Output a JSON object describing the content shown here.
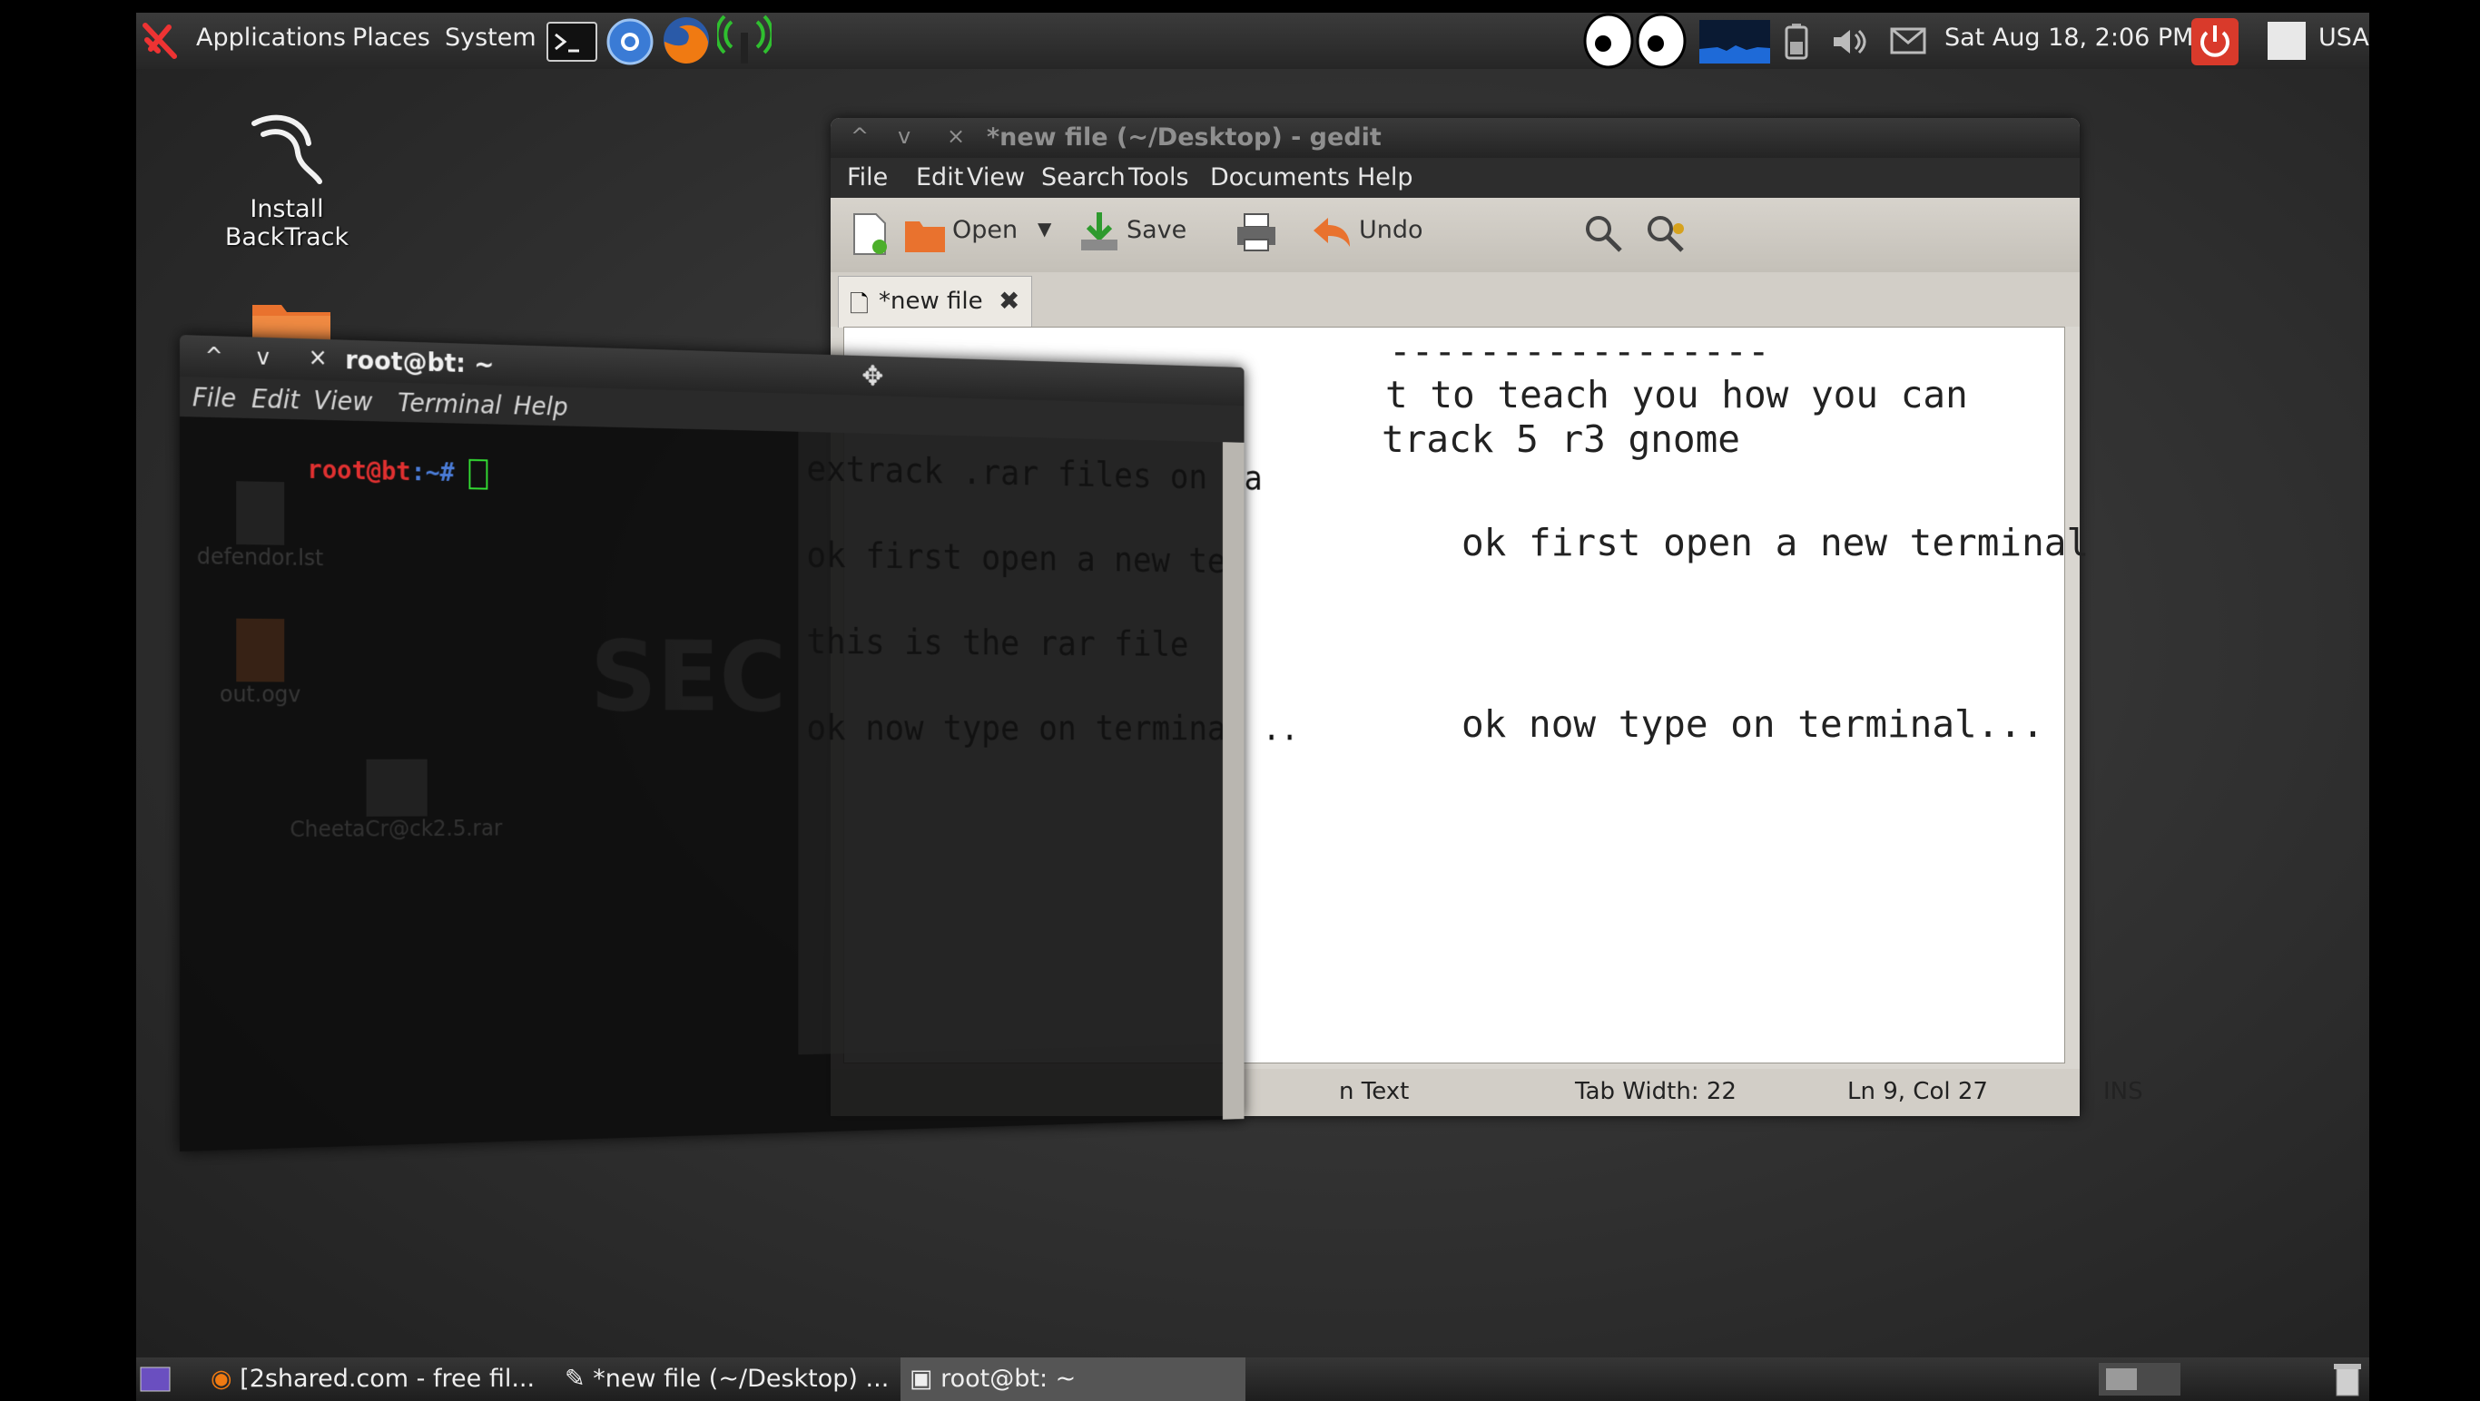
{
  "top_panel": {
    "menus": [
      "Applications",
      "Places",
      "System"
    ],
    "datetime": "Sat Aug 18,  2:06 PM",
    "keyboard_layout": "USA"
  },
  "desktop": {
    "install_label": "Install BackTrack",
    "faded_icons": [
      "defendor.lst",
      "out.ogv",
      "CheetaCr@ck2.5.rar"
    ],
    "wallpaper_text": "SEC"
  },
  "gedit": {
    "title": "*new file (~/Desktop) - gedit",
    "menu": [
      "File",
      "Edit",
      "View",
      "Search",
      "Tools",
      "Documents",
      "Help"
    ],
    "toolbar": {
      "open": "Open",
      "save": "Save",
      "undo": "Undo"
    },
    "tab_label": "*new file",
    "lines": [
      "-----------------",
      "t to teach you how you can",
      "track 5 r3 gnome",
      "ok first open a new terminal",
      "this is the rar file",
      "ok now type on terminal..."
    ],
    "lines_under_terminal": [
      "extrack .rar files on ba",
      "ok first open a new ter",
      "this is the rar file",
      "ok now type on terminal .."
    ],
    "status": {
      "lang": "n Text",
      "tab_width": "Tab Width: 22",
      "cursor": "Ln 9, Col 27",
      "mode": "INS"
    }
  },
  "terminal": {
    "title": "root@bt: ~",
    "menu": [
      "File",
      "Edit",
      "View",
      "Terminal",
      "Help"
    ],
    "prompt_user": "root@bt",
    "prompt_rest": ":~# "
  },
  "taskbar": {
    "items": [
      "[2shared.com - free fil...",
      "*new file (~/Desktop) ...",
      "root@bt: ~"
    ]
  },
  "colors": {
    "accent_red": "#d93a2b",
    "prompt_red": "#e03030",
    "cursor_green": "#33dd33"
  }
}
